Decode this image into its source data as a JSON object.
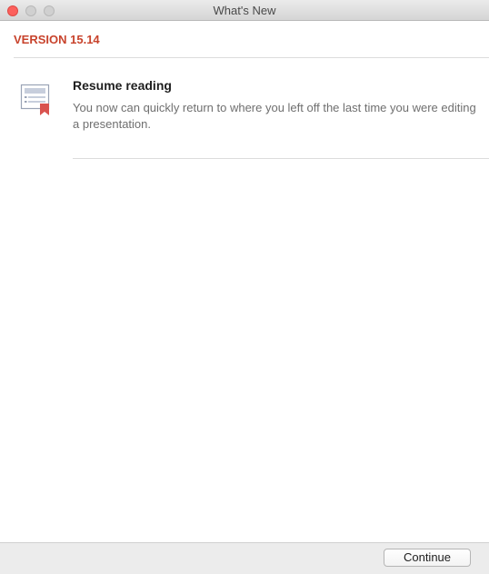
{
  "window": {
    "title": "What's New"
  },
  "version": {
    "label": "VERSION 15.14"
  },
  "features": [
    {
      "icon": "resume-reading-icon",
      "title": "Resume reading",
      "description": "You now can quickly return to where you left off the last time you were editing a presentation."
    }
  ],
  "footer": {
    "continue_label": "Continue"
  },
  "colors": {
    "accent": "#c8432c",
    "close_button": "#fc605c"
  }
}
